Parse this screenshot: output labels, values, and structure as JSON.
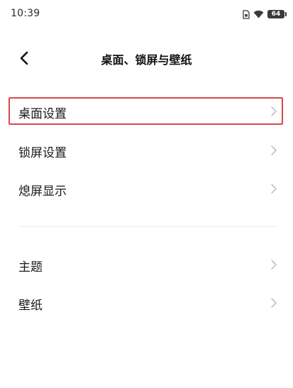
{
  "status_bar": {
    "time": "10:39",
    "battery_level": "64"
  },
  "header": {
    "title": "桌面、锁屏与壁纸"
  },
  "sections": [
    {
      "items": [
        {
          "label": "桌面设置",
          "highlighted": true
        },
        {
          "label": "锁屏设置"
        },
        {
          "label": "熄屏显示"
        }
      ]
    },
    {
      "items": [
        {
          "label": "主题"
        },
        {
          "label": "壁纸"
        }
      ]
    }
  ],
  "colors": {
    "highlight_border": "#d9474d",
    "chevron": "#b5b5b5",
    "text": "#1a1a1a"
  },
  "icons": {
    "back": "chevron-left-icon",
    "row_arrow": "chevron-right-icon"
  }
}
